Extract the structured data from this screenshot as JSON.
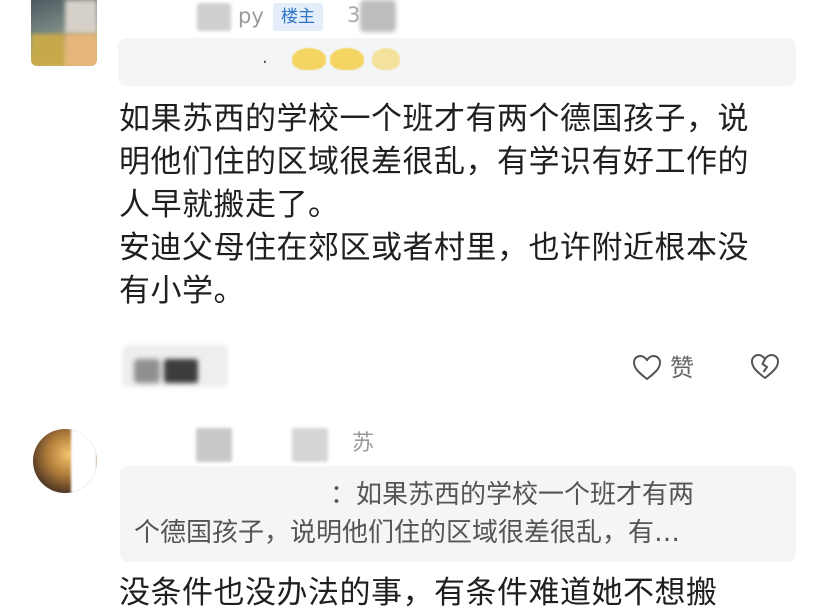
{
  "comments": [
    {
      "author_suffix": "py",
      "op_badge": "楼主",
      "time_partial": "3",
      "body_lines": [
        "如果苏西的学校一个班才有两个德国孩子，说",
        "明他们住的区域很差很乱，有学识有好工作的",
        "人早就搬走了。",
        "安迪父母住在郊区或者村里，也许附近根本没",
        "有小学。"
      ],
      "like_label": "赞"
    },
    {
      "author_suffix": "苏",
      "quote_line1": "：如果苏西的学校一个班才有两",
      "quote_line2": "个德国孩子，说明他们住的区域很差很乱，有…",
      "body_partial": "没条件也没办法的事，有条件难道她不想搬"
    }
  ],
  "icons": {
    "like": "heart-outline-icon",
    "dislike": "broken-heart-icon"
  },
  "colors": {
    "op_badge_bg": "#e3eefa",
    "op_badge_text": "#2f74c7",
    "quote_bg": "#f4f5f6"
  }
}
